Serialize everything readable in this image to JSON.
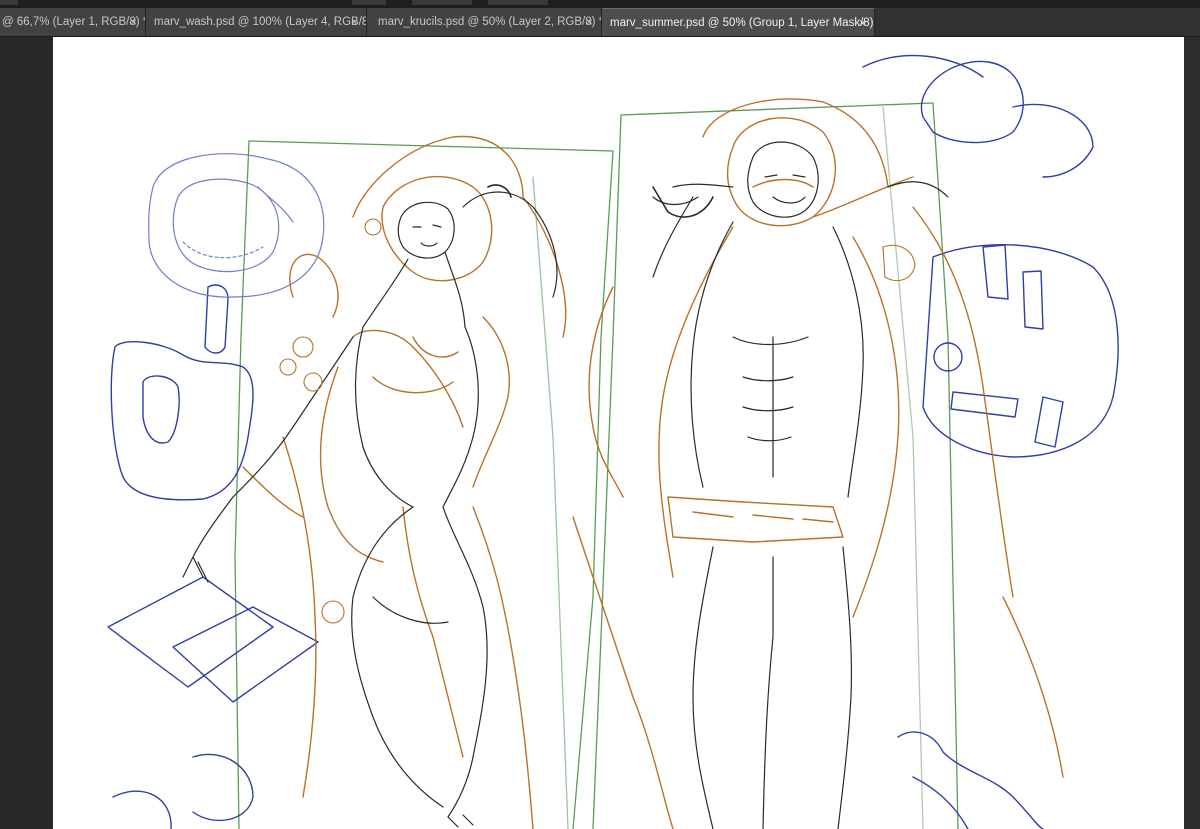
{
  "tabs": [
    {
      "label": "@ 66,7% (Layer 1, RGB/8) *",
      "close": "×",
      "active": false
    },
    {
      "label": "marv_wash.psd @ 100% (Layer 4, RGB/8)",
      "close": "×",
      "active": false
    },
    {
      "label": "marv_krucils.psd @ 50% (Layer 2, RGB/8) *",
      "close": "×",
      "active": false
    },
    {
      "label": "marv_summer.psd @ 50% (Group 1, Layer Mask/8) *",
      "close": "×",
      "active": true
    }
  ],
  "colors": {
    "sketch_orange": "#b8722a",
    "sketch_green": "#3f8a3a",
    "sketch_blue": "#2f3fa6",
    "sketch_lightblue": "#6f80c8",
    "sketch_black": "#2a2a2a",
    "canvas_bg": "#ffffff",
    "workspace_bg": "#282828"
  }
}
